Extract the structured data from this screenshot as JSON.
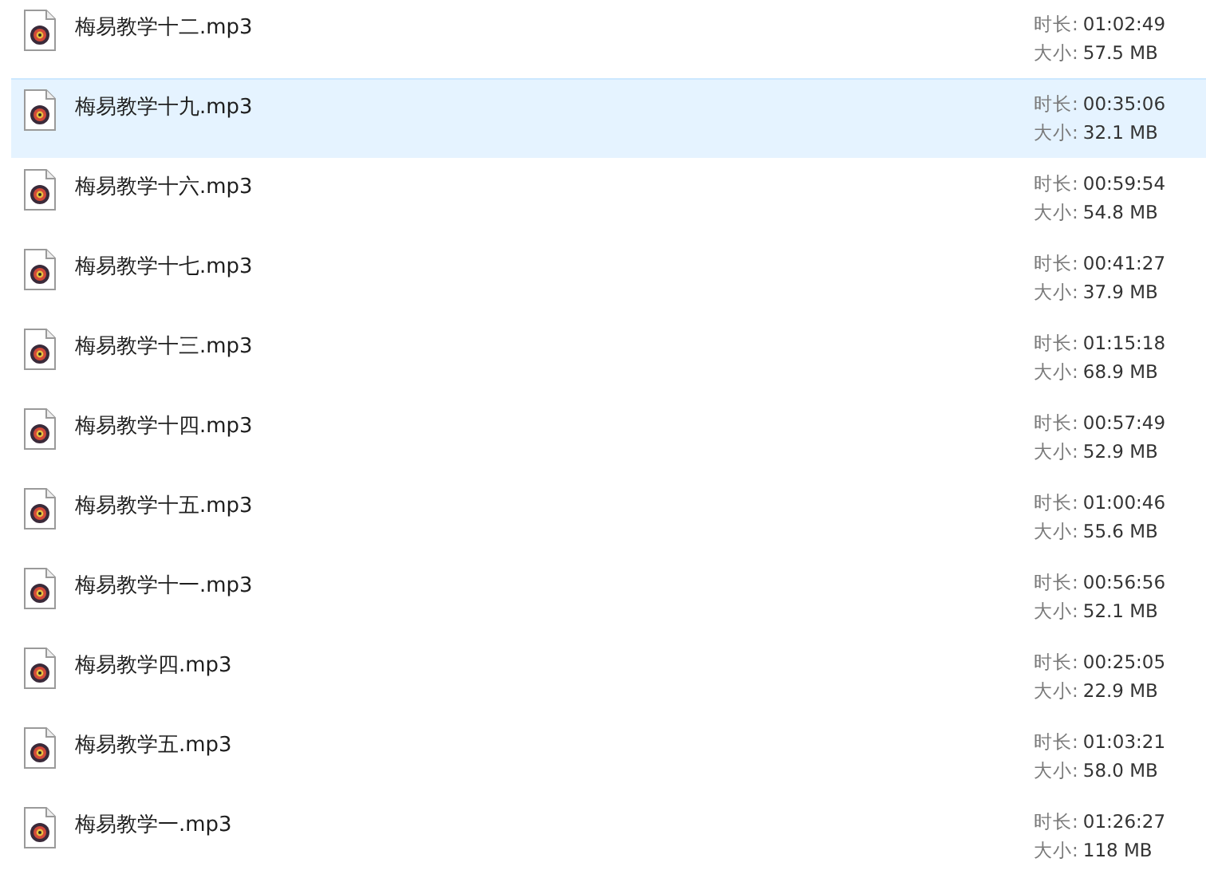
{
  "files": [
    {
      "name": "梅易教学十二.mp3",
      "duration_label": "时长:",
      "duration": "01:02:49",
      "size_label": "大小:",
      "size": "57.5 MB",
      "selected": false
    },
    {
      "name": "梅易教学十九.mp3",
      "duration_label": "时长:",
      "duration": "00:35:06",
      "size_label": "大小:",
      "size": "32.1 MB",
      "selected": true
    },
    {
      "name": "梅易教学十六.mp3",
      "duration_label": "时长:",
      "duration": "00:59:54",
      "size_label": "大小:",
      "size": "54.8 MB",
      "selected": false
    },
    {
      "name": "梅易教学十七.mp3",
      "duration_label": "时长:",
      "duration": "00:41:27",
      "size_label": "大小:",
      "size": "37.9 MB",
      "selected": false
    },
    {
      "name": "梅易教学十三.mp3",
      "duration_label": "时长:",
      "duration": "01:15:18",
      "size_label": "大小:",
      "size": "68.9 MB",
      "selected": false
    },
    {
      "name": "梅易教学十四.mp3",
      "duration_label": "时长:",
      "duration": "00:57:49",
      "size_label": "大小:",
      "size": "52.9 MB",
      "selected": false
    },
    {
      "name": "梅易教学十五.mp3",
      "duration_label": "时长:",
      "duration": "01:00:46",
      "size_label": "大小:",
      "size": "55.6 MB",
      "selected": false
    },
    {
      "name": "梅易教学十一.mp3",
      "duration_label": "时长:",
      "duration": "00:56:56",
      "size_label": "大小:",
      "size": "52.1 MB",
      "selected": false
    },
    {
      "name": "梅易教学四.mp3",
      "duration_label": "时长:",
      "duration": "00:25:05",
      "size_label": "大小:",
      "size": "22.9 MB",
      "selected": false
    },
    {
      "name": "梅易教学五.mp3",
      "duration_label": "时长:",
      "duration": "01:03:21",
      "size_label": "大小:",
      "size": "58.0 MB",
      "selected": false
    },
    {
      "name": "梅易教学一.mp3",
      "duration_label": "时长:",
      "duration": "01:26:27",
      "size_label": "大小:",
      "size": "118 MB",
      "selected": false
    }
  ]
}
